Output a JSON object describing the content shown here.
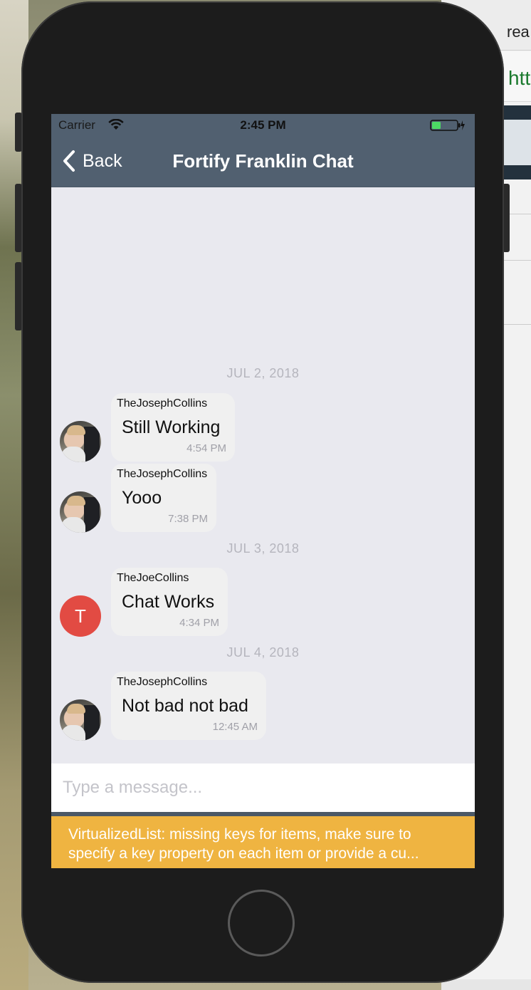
{
  "background": {
    "browser_tab_text": "rea",
    "browser_url_text": "htt"
  },
  "status_bar": {
    "carrier": "Carrier",
    "time": "2:45 PM",
    "battery_color": "#4cd964"
  },
  "nav": {
    "back_label": "Back",
    "title": "Fortify Franklin Chat",
    "bar_color": "#516070"
  },
  "chat": {
    "dates": [
      "JUL 2, 2018",
      "JUL 3, 2018",
      "JUL 4, 2018"
    ],
    "messages": [
      {
        "user": "TheJosephCollins",
        "text": "Still Working",
        "time": "4:54 PM",
        "avatar": "photo"
      },
      {
        "user": "TheJosephCollins",
        "text": "Yooo",
        "time": "7:38 PM",
        "avatar": "photo"
      },
      {
        "user": "TheJoeCollins",
        "text": "Chat Works",
        "time": "4:34 PM",
        "avatar": "initial",
        "initial": "T"
      },
      {
        "user": "TheJosephCollins",
        "text": "Not bad not bad",
        "time": "12:45 AM",
        "avatar": "photo"
      }
    ]
  },
  "composer": {
    "placeholder": "Type a message..."
  },
  "warning": {
    "line1": "VirtualizedList: missing keys for items, make sure to",
    "line2": "specify a key property on each item or provide a cu...",
    "color": "#efb441"
  }
}
